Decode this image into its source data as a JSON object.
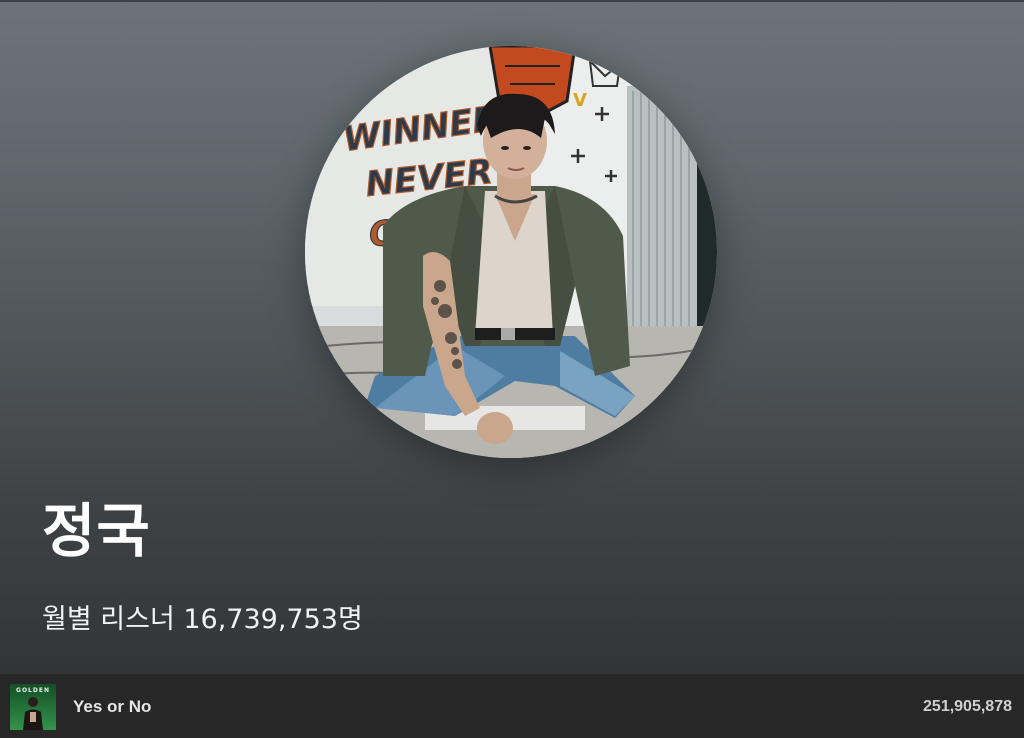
{
  "artist": {
    "name": "정국",
    "monthly_listeners_text": "월별 리스너 16,739,753명"
  },
  "artwork_text": {
    "graffiti_line_1": "WINNERS",
    "graffiti_line_2": "NEVER",
    "graffiti_line_3": "QUIT",
    "album_cover_label": "GOLDEN"
  },
  "top_track": {
    "title": "Yes or No",
    "play_count": "251,905,878"
  },
  "colors": {
    "hero_top": "#6b7479",
    "hero_bottom": "#333436",
    "track_bar": "#272727",
    "album_green": "#1f7a3a"
  },
  "icons": {
    "artist_photo": "artist-portrait-image",
    "album_thumb": "album-cover-image"
  }
}
